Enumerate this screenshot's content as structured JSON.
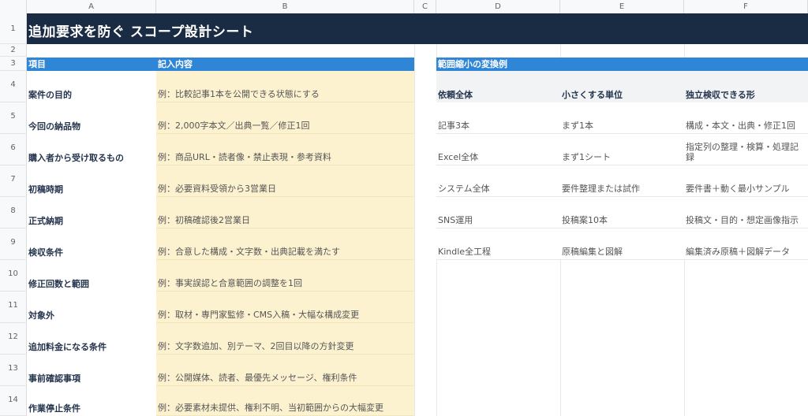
{
  "columns": [
    "A",
    "B",
    "C",
    "D",
    "E",
    "F"
  ],
  "rows": [
    "1",
    "2",
    "3",
    "4",
    "5",
    "6",
    "7",
    "8",
    "9",
    "10",
    "11",
    "12",
    "13",
    "14"
  ],
  "title": "追加要求を防ぐ スコープ設計シート",
  "left_table": {
    "header_item": "項目",
    "header_content": "記入内容",
    "rows": [
      {
        "item": "案件の目的",
        "content": "例：比較記事1本を公開できる状態にする"
      },
      {
        "item": "今回の納品物",
        "content": "例：2,000字本文／出典一覧／修正1回"
      },
      {
        "item": "購入者から受け取るもの",
        "content": "例：商品URL・読者像・禁止表現・参考資料"
      },
      {
        "item": "初稿時期",
        "content": "例：必要資料受領から3営業日"
      },
      {
        "item": "正式納期",
        "content": "例：初稿確認後2営業日"
      },
      {
        "item": "検収条件",
        "content": "例：合意した構成・文字数・出典記載を満たす"
      },
      {
        "item": "修正回数と範囲",
        "content": "例：事実誤認と合意範囲の調整を1回"
      },
      {
        "item": "対象外",
        "content": "例：取材・専門家監修・CMS入稿・大幅な構成変更"
      },
      {
        "item": "追加料金になる条件",
        "content": "例：文字数追加、別テーマ、2回目以降の方針変更"
      },
      {
        "item": "事前確認事項",
        "content": "例：公開媒体、読者、最優先メッセージ、権利条件"
      },
      {
        "item": "作業停止条件",
        "content": "例：必要素材未提供、権利不明、当初範囲からの大幅変更"
      }
    ]
  },
  "right_table": {
    "section_title": "範囲縮小の変換例",
    "headers": [
      "依頼全体",
      "小さくする単位",
      "独立検収できる形"
    ],
    "rows": [
      [
        "記事3本",
        "まず1本",
        "構成・本文・出典・修正1回"
      ],
      [
        "Excel全体",
        "まず1シート",
        "指定列の整理・検算・処理記録"
      ],
      [
        "システム全体",
        "要件整理または試作",
        "要件書＋動く最小サンプル"
      ],
      [
        "SNS運用",
        "投稿案10本",
        "投稿文・目的・想定画像指示"
      ],
      [
        "Kindle全工程",
        "原稿編集と図解",
        "編集済み原稿＋図解データ"
      ]
    ]
  },
  "colors": {
    "title_bg": "#1a2b44",
    "header_blue": "#2f86d6",
    "input_fill": "#fdf2cf"
  }
}
